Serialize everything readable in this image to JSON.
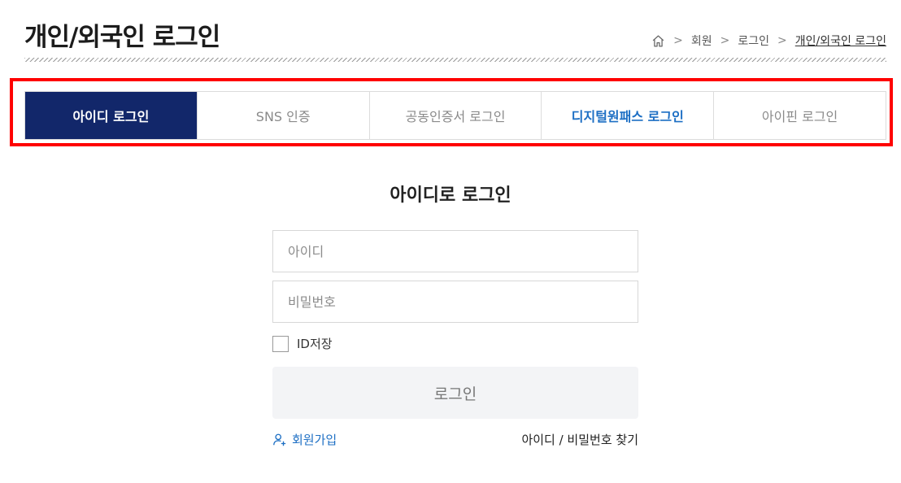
{
  "page": {
    "title": "개인/외국인 로그인"
  },
  "breadcrumb": {
    "home_icon": "home-icon",
    "items": [
      "회원",
      "로그인",
      "개인/외국인 로그인"
    ]
  },
  "tabs": [
    {
      "label": "아이디 로그인",
      "state": "active"
    },
    {
      "label": "SNS 인증",
      "state": "normal"
    },
    {
      "label": "공동인증서 로그인",
      "state": "normal"
    },
    {
      "label": "디지털원패스 로그인",
      "state": "highlight"
    },
    {
      "label": "아이핀 로그인",
      "state": "normal"
    }
  ],
  "login": {
    "heading": "아이디로 로그인",
    "id_placeholder": "아이디",
    "password_placeholder": "비밀번호",
    "save_id_label": "ID저장",
    "save_id_checked": false,
    "submit_label": "로그인",
    "join_label": "회원가입",
    "find_label": "아이디 / 비밀번호 찾기"
  },
  "colors": {
    "active_tab_bg": "#12276a",
    "link_blue": "#1d6fc4",
    "highlight_frame": "#ff0000"
  }
}
